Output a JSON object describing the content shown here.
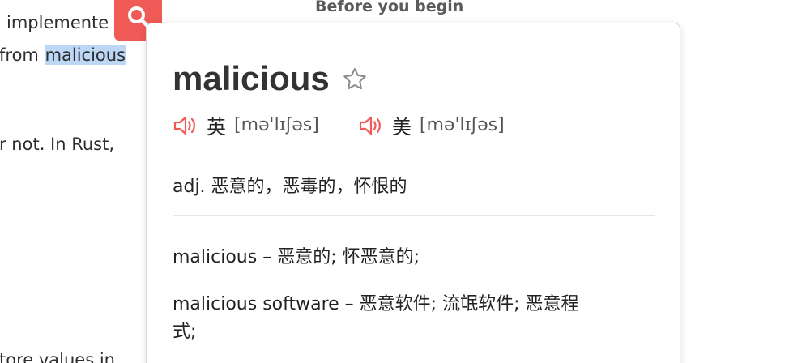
{
  "document": {
    "heading": "Before you begin",
    "lines": [
      "implemente",
      "from",
      "r not. In Rust,",
      "tore values in"
    ],
    "highlighted_word": "malicious"
  },
  "search_button": {
    "icon": "search-icon",
    "color": "#f05a57"
  },
  "popup": {
    "word": "malicious",
    "favorite_icon": "star-outline-icon",
    "pronunciations": [
      {
        "accent": "英",
        "ipa": "[məˈlɪʃəs]",
        "icon": "speaker-icon"
      },
      {
        "accent": "美",
        "ipa": "[məˈlɪʃəs]",
        "icon": "speaker-icon"
      }
    ],
    "definition": "adj. 恶意的，恶毒的，怀恨的",
    "phrases": [
      "malicious – 恶意的; 怀恶意的;",
      "malicious software – 恶意软件; 流氓软件; 恶意程",
      "式;"
    ],
    "accent_color": "#f05a57"
  }
}
